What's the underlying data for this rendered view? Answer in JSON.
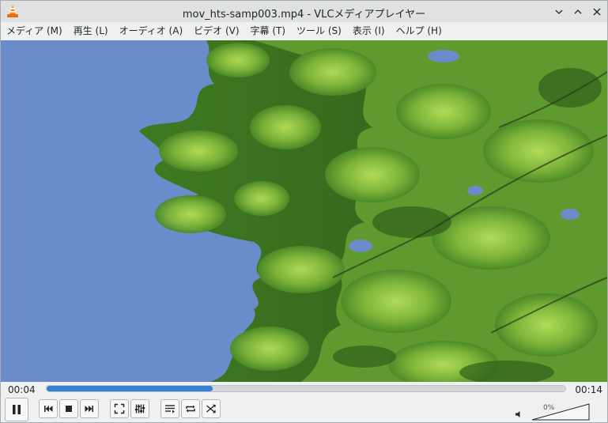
{
  "window": {
    "title": "mov_hts-samp003.mp4 - VLCメディアプレイヤー"
  },
  "menu": [
    {
      "label": "メディア (M)"
    },
    {
      "label": "再生 (L)"
    },
    {
      "label": "オーディオ (A)"
    },
    {
      "label": "ビデオ (V)"
    },
    {
      "label": "字幕 (T)"
    },
    {
      "label": "ツール (S)"
    },
    {
      "label": "表示 (I)"
    },
    {
      "label": "ヘルプ (H)"
    }
  ],
  "playback": {
    "elapsed": "00:04",
    "total": "00:14",
    "progress_fraction": 0.32
  },
  "volume": {
    "label": "0%",
    "level_fraction": 0.0
  },
  "icons": {
    "app": "vlc-cone-icon",
    "minimize": "chevron-down-icon",
    "maximize": "chevron-up-icon",
    "close": "close-icon",
    "play_pause": "pause-icon",
    "previous": "skip-previous-icon",
    "stop": "stop-icon",
    "next": "skip-next-icon",
    "fullscreen": "fullscreen-icon",
    "extended": "equalizer-icon",
    "playlist": "playlist-icon",
    "loop": "loop-icon",
    "random": "shuffle-icon",
    "volume": "speaker-icon"
  },
  "colors": {
    "accent": "#3281d3",
    "sky": "#6b8ccb",
    "foliage": "#5e9a2e"
  }
}
